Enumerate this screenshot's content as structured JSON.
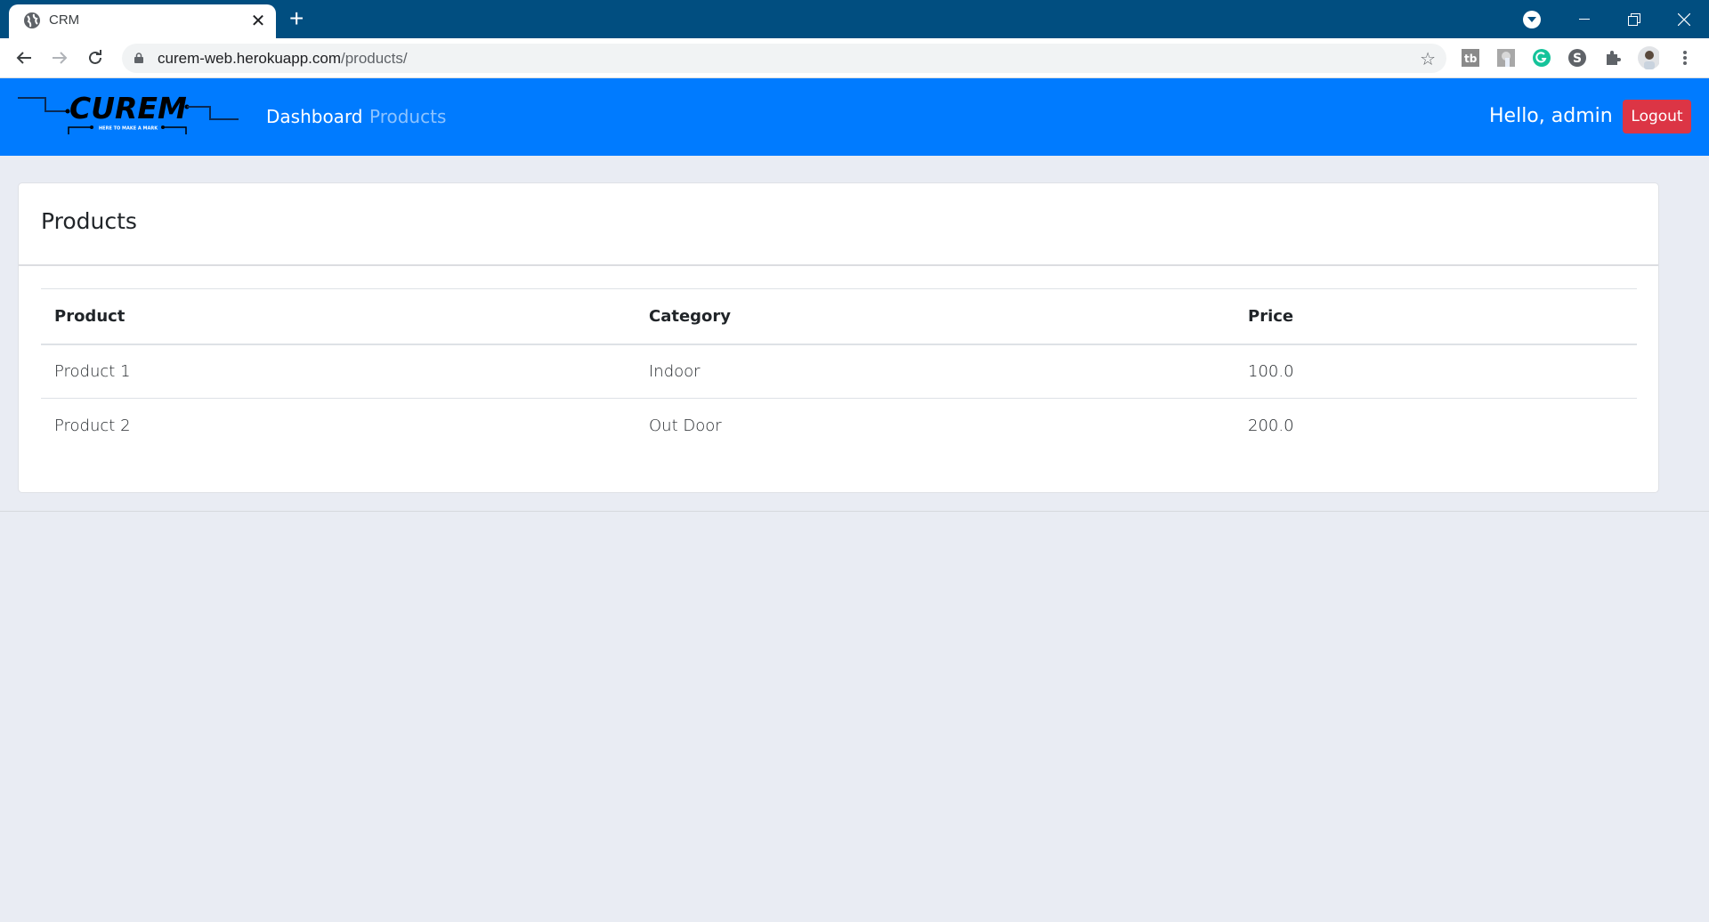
{
  "browser": {
    "tab_title": "CRM",
    "new_tab_label": "+",
    "url_host": "curem-web.herokuapp.com",
    "url_path": "/products/",
    "extensions": [
      "tb-icon",
      "touch-icon",
      "grammarly-icon",
      "s-extension-icon",
      "puzzle-icon",
      "profile-avatar"
    ],
    "window_controls": {
      "minimize": "—",
      "restore": "❐",
      "close": "✕"
    }
  },
  "navbar": {
    "brand": "CUREM",
    "tagline": "HERE TO MAKE A MARK",
    "links": [
      {
        "label": "Dashboard",
        "active": false
      },
      {
        "label": "Products",
        "active": true
      }
    ],
    "greeting": "Hello, admin",
    "logout_label": "Logout",
    "colors": {
      "navbar": "#007bff",
      "logout": "#dc3545"
    }
  },
  "page": {
    "title": "Products",
    "table": {
      "headers": [
        "Product",
        "Category",
        "Price"
      ],
      "rows": [
        [
          "Product 1",
          "Indoor",
          "100.0"
        ],
        [
          "Product 2",
          "Out Door",
          "200.0"
        ]
      ]
    }
  }
}
